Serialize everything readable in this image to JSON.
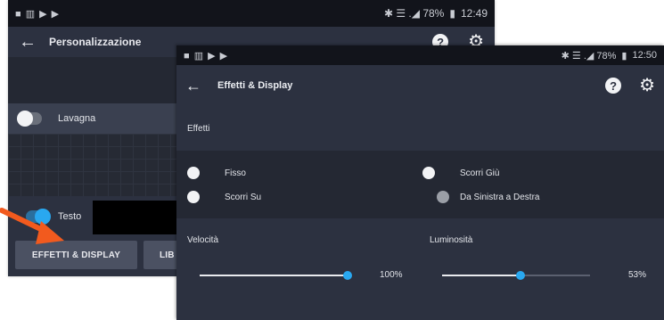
{
  "back_screen": {
    "status": {
      "left_icons": "■ ▥ ▶ ▶",
      "right_icons": "✱ ☰ .◢ 78%",
      "time": "12:49"
    },
    "title": "Personalizzazione",
    "row_lavagna": "Lavagna",
    "row_testo": "Testo",
    "buttons": {
      "effetti": "EFFETTI & DISPLAY",
      "second_partial": "LIB"
    }
  },
  "front_screen": {
    "status": {
      "left_icons": "■ ▥ ▶ ▶",
      "right_icons": "✱ ☰ .◢ 78%",
      "time": "12:50"
    },
    "title": "Effetti & Display",
    "section_effects": "Effetti",
    "options": {
      "fisso": "Fisso",
      "scorri_giu": "Scorri Giù",
      "scorri_su": "Scorri Su",
      "sinistra_destra": "Da Sinistra a Destra"
    },
    "velocita_label": "Velocità",
    "luminosita_label": "Luminosità",
    "velocita_value": "100%",
    "luminosita_value": "53%",
    "velocita_level": 1.0,
    "luminosita_level": 0.53
  },
  "icons": {
    "back": "arrow-left-icon",
    "help": "help-icon",
    "settings": "gear-icon"
  },
  "colors": {
    "accent": "#29a8f0",
    "arrow": "#f25a1e",
    "background": "#2c3140"
  }
}
